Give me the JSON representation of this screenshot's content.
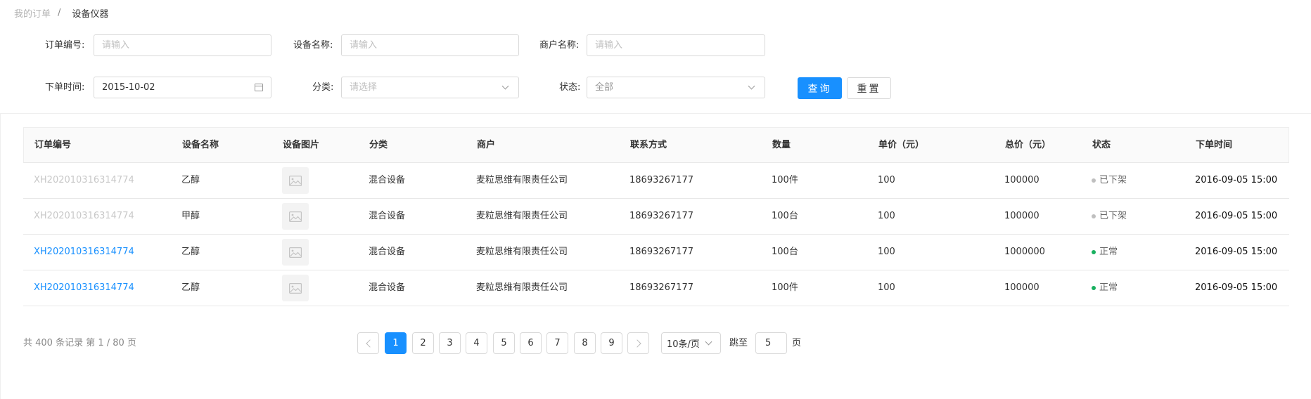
{
  "breadcrumb": {
    "parent": "我的订单",
    "separator": "/",
    "current": "设备仪器"
  },
  "filters": {
    "order_no": {
      "label": "订单编号:",
      "placeholder": "请输入",
      "value": ""
    },
    "device_name": {
      "label": "设备名称:",
      "placeholder": "请输入",
      "value": ""
    },
    "merchant_name": {
      "label": "商户名称:",
      "placeholder": "请输入",
      "value": ""
    },
    "order_time": {
      "label": "下单时间:",
      "value": "2015-10-02"
    },
    "category": {
      "label": "分类:",
      "placeholder": "请选择"
    },
    "status": {
      "label": "状态:",
      "value": "全部"
    },
    "query_button": "查询",
    "reset_button": "重置"
  },
  "table": {
    "headers": [
      "订单编号",
      "设备名称",
      "设备图片",
      "分类",
      "商户",
      "联系方式",
      "数量",
      "单价（元）",
      "总价（元）",
      "状态",
      "下单时间"
    ],
    "rows": [
      {
        "order_no": "XH202010316314774",
        "device": "乙醇",
        "category": "混合设备",
        "merchant": "麦粒思维有限责任公司",
        "contact": "18693267177",
        "quantity": "100件",
        "unit_price": "100",
        "total_price": "100000",
        "status": "已下架",
        "status_state": "inactive",
        "time": "2016-09-05 15:00"
      },
      {
        "order_no": "XH202010316314774",
        "device": "甲醇",
        "category": "混合设备",
        "merchant": "麦粒思维有限责任公司",
        "contact": "18693267177",
        "quantity": "100台",
        "unit_price": "100",
        "total_price": "100000",
        "status": "已下架",
        "status_state": "inactive",
        "time": "2016-09-05 15:00"
      },
      {
        "order_no": "XH202010316314774",
        "device": "乙醇",
        "category": "混合设备",
        "merchant": "麦粒思维有限责任公司",
        "contact": "18693267177",
        "quantity": "100台",
        "unit_price": "100",
        "total_price": "1000000",
        "status": "正常",
        "status_state": "active",
        "time": "2016-09-05 15:00"
      },
      {
        "order_no": "XH202010316314774",
        "device": "乙醇",
        "category": "混合设备",
        "merchant": "麦粒思维有限责任公司",
        "contact": "18693267177",
        "quantity": "100件",
        "unit_price": "100",
        "total_price": "100000",
        "status": "正常",
        "status_state": "active",
        "time": "2016-09-05 15:00"
      }
    ]
  },
  "pagination": {
    "total_text": "共 400 条记录 第 1 / 80 页",
    "pages": [
      "1",
      "2",
      "3",
      "4",
      "5",
      "6",
      "7",
      "8",
      "9"
    ],
    "current_page": "1",
    "page_size": "10条/页",
    "jump_label": "跳至",
    "jump_value": "5",
    "page_suffix": "页"
  },
  "colors": {
    "primary": "#1890ff",
    "status_active": "#18b05f",
    "status_inactive": "#bfbfbf",
    "inactive_id": "#c8c8c8"
  },
  "icons": {
    "date_picker": "calendar-icon",
    "select": "chevron-down-icon",
    "thumbnail": "image-placeholder-icon",
    "prev": "chevron-left-icon",
    "next": "chevron-right-icon"
  }
}
